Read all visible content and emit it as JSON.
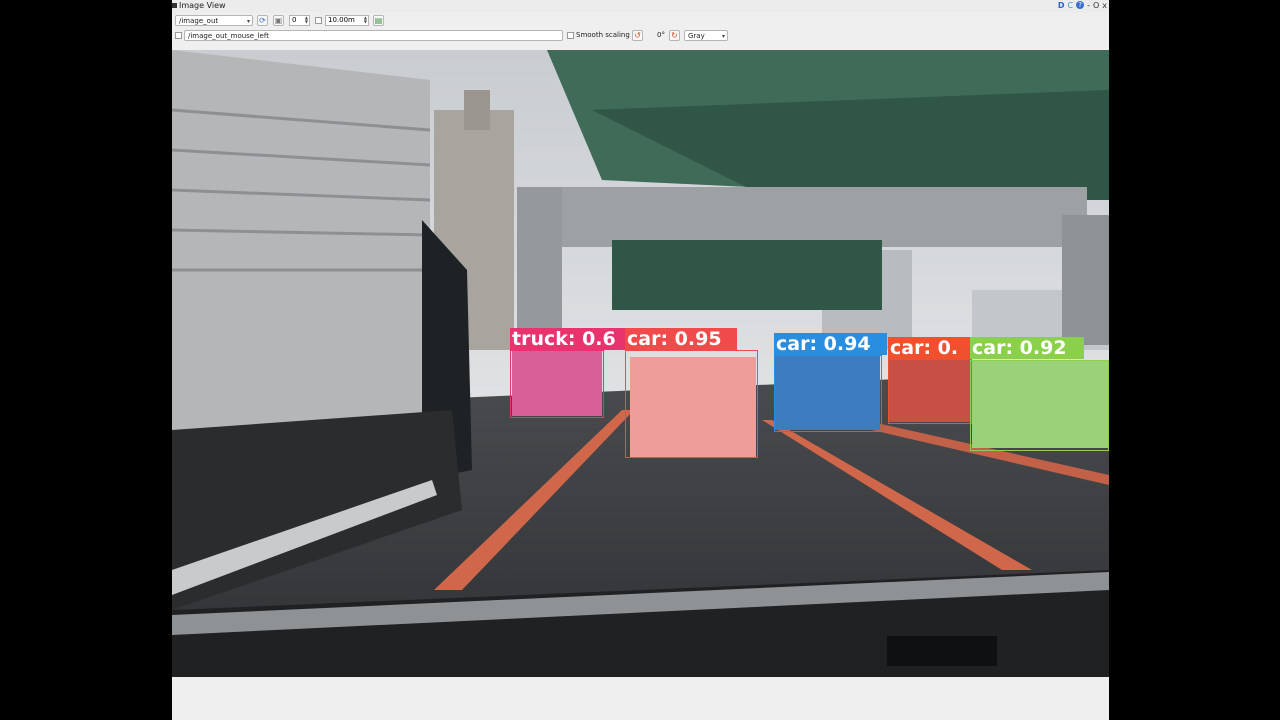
{
  "window": {
    "title": "Image View",
    "titlebar_icons": [
      "D",
      "C",
      "?",
      "-",
      "O",
      "x"
    ]
  },
  "toolbar": {
    "topic": "/image_out",
    "spin_value": "0",
    "time_value": "10.00m",
    "mouse_topic": "/image_out_mouse_left",
    "smooth_scaling_label": "Smooth scaling",
    "rotation": "0°",
    "colormap": "Gray"
  },
  "detections": [
    {
      "label": "truck: 0.6",
      "color": "#e8336f"
    },
    {
      "label": "car: 0.95",
      "color": "#f04a4a"
    },
    {
      "label": "car: 0.94",
      "color": "#2a8ee0"
    },
    {
      "label": "car: 0.",
      "color": "#f0502e"
    },
    {
      "label": "car: 0.92",
      "color": "#8ad04a"
    }
  ]
}
